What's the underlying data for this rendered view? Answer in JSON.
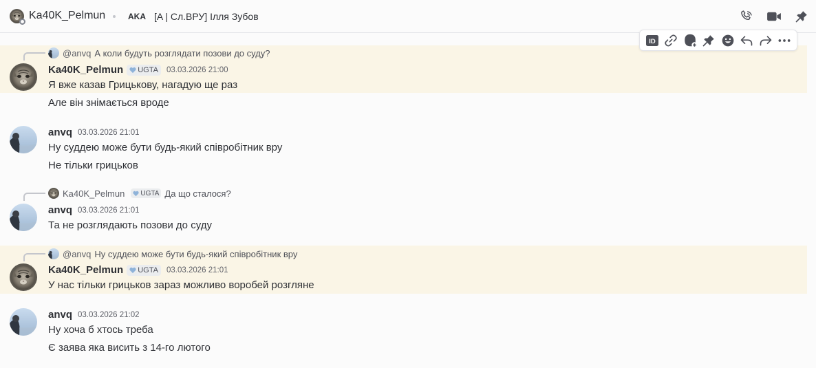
{
  "header": {
    "channel_name": "Ka40K_Pelmun",
    "tag": "AKA",
    "status_text": "[A | Сл.ВРУ] Ілля Зубов",
    "icons": [
      "voice-call-icon",
      "video-call-icon",
      "pin-icon"
    ]
  },
  "toolbar": {
    "icons": [
      "copy-id-icon",
      "copy-link-icon",
      "add-reaction-icon",
      "pin-message-icon",
      "emoji-icon",
      "reply-icon",
      "forward-icon",
      "more-icon"
    ],
    "copy_id_glyph": "ID"
  },
  "colors": {
    "highlight": "#faf5e6",
    "text": "#2e3035",
    "muted": "#5c5e66"
  },
  "messages": [
    {
      "reply": {
        "author": "@anvq",
        "text": "А коли будуть розглядати позови до суду?"
      },
      "author": "Ka40K_Pelmun",
      "clan": "UGTA",
      "timestamp": "03.03.2026 21:00",
      "lines": [
        "Я вже казав Грицькову, нагадую ще раз",
        "Але він знімається вроде"
      ]
    },
    {
      "author": "anvq",
      "timestamp": "03.03.2026 21:01",
      "lines": [
        "Ну суддею може бути будь-який співробітник вру",
        "Не тільки грицьков"
      ]
    },
    {
      "reply": {
        "author": "Ka40K_Pelmun",
        "clan": "UGTA",
        "text": "Да що сталося?"
      },
      "author": "anvq",
      "timestamp": "03.03.2026 21:01",
      "lines": [
        "Та не розглядають позови до суду"
      ]
    },
    {
      "reply": {
        "author": "@anvq",
        "text": "Ну суддею може бути будь-який співробітник вру"
      },
      "author": "Ka40K_Pelmun",
      "clan": "UGTA",
      "timestamp": "03.03.2026 21:01",
      "lines": [
        "У нас тільки грицьков зараз можливо воробей розгляне"
      ]
    },
    {
      "author": "anvq",
      "timestamp": "03.03.2026 21:02",
      "lines": [
        "Ну хоча б хтось треба",
        "Є заява яка висить з 14-го лютого"
      ]
    }
  ]
}
